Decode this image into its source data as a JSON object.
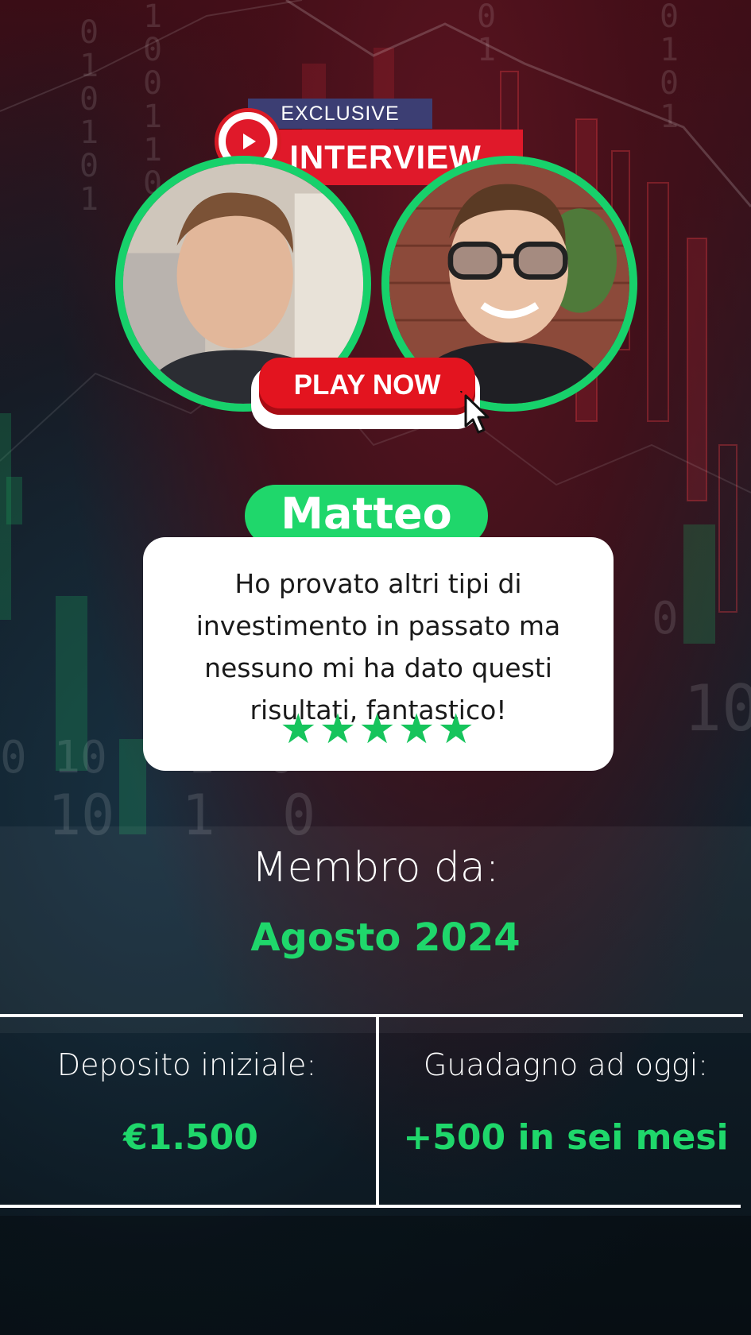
{
  "badge": {
    "top": "EXCLUSIVE",
    "main": "INTERVIEW",
    "icon": "play-icon"
  },
  "play_button": {
    "label": "PLAY NOW",
    "icon": "pointer-cursor-icon"
  },
  "person": {
    "name": "Matteo"
  },
  "testimonial": {
    "lines": [
      "Ho provato altri tipi di",
      "investimento in passato ma",
      "nessuno mi ha dato questi",
      "risultati, fantastico!"
    ],
    "rating": 5,
    "stars": "★★★★★"
  },
  "membership": {
    "label": "Membro da:",
    "date": "Agosto 2024"
  },
  "stats": {
    "deposit_label": "Deposito iniziale:",
    "deposit_value": "€1.500",
    "gain_label": "Guadagno ad oggi:",
    "gain_value": "+500 in sei mesi"
  },
  "colors": {
    "accent_green": "#1fd76b",
    "badge_red": "#e0192a",
    "badge_navy": "#3c3e73",
    "avatar_ring": "#17d16b"
  }
}
